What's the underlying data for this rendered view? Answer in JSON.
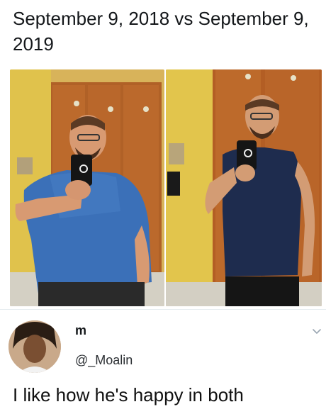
{
  "post": {
    "caption": "September 9, 2018 vs September 9, 2019"
  },
  "photos": {
    "left_alt": "before photo",
    "right_alt": "after photo"
  },
  "reply": {
    "name": "m",
    "handle": "@_Moalin",
    "text": "I like how he's happy in both",
    "icons": {
      "menu": "chevron-down-icon"
    }
  },
  "colors": {
    "locker_wood": "#b5652a",
    "wall_yellow": "#e6c84a",
    "shirt_blue_2018": "#3a6fb7",
    "shirt_navy_2019": "#1e2c4e",
    "accent_muted": "#9aa6b2"
  }
}
